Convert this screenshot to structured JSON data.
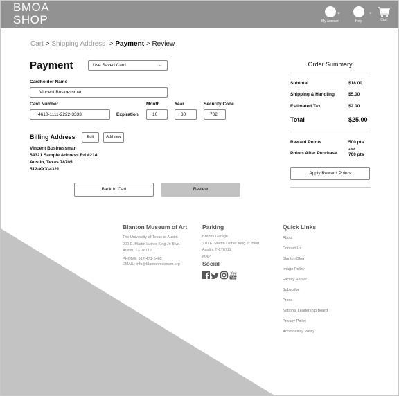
{
  "header": {
    "logo_line1": "BMOA",
    "logo_line2": "SHOP",
    "account_label": "My Account",
    "help_label": "Help",
    "cart_label": "Cart"
  },
  "breadcrumb": {
    "cart": "Cart",
    "sep1": ">",
    "shipping": "Shipping Address",
    "sep2": ">",
    "payment": "Payment",
    "sep3": ">",
    "review": "Review"
  },
  "payment": {
    "title": "Payment",
    "saved_card_select": "Use Saved Card",
    "cardholder_label": "Cardholder Name",
    "cardholder_value": "Vincent Businessman",
    "card_number_label": "Card Number",
    "card_number_value": "4610-1111-2222-3333",
    "expiration_label": "Expiration",
    "month_label": "Month",
    "month_value": "10",
    "year_label": "Year",
    "year_value": "30",
    "security_label": "Security Code",
    "security_value": "702"
  },
  "billing": {
    "title": "Billing Address",
    "edit_label": "Edit",
    "add_new_label": "Add new",
    "name": "Vincent Businessman",
    "street": "54321 Sample Address Rd #214",
    "city": "Austin, Texas 78705",
    "phone": "512-XXX-4321"
  },
  "actions": {
    "back_label": "Back to Cart",
    "review_label": "Review"
  },
  "summary": {
    "title": "Order Summary",
    "subtotal_label": "Subtotal",
    "subtotal_value": "$18.00",
    "shipping_label": "Shipping & Handling",
    "shipping_value": "$5.00",
    "tax_label": "Estimated Tax",
    "tax_value": "$2.00",
    "total_label": "Total",
    "total_value": "$25.00",
    "reward_label": "Reward Points",
    "reward_value": "500 pts",
    "after_label": "Points After Purchase",
    "after_plus": "+200",
    "after_value": "700 pts",
    "apply_label": "Apply Reward Points"
  },
  "footer": {
    "museum_title": "Blanton Museum of Art",
    "museum_line1": "The University of Texas at Austin",
    "museum_line2": "200 E. Martin Luther King Jr. Blvd.",
    "museum_line3": "Austin, TX 78712",
    "phone": "PHONE: 512-471-5482",
    "email": "EMAIL: info@blantonmuseum.org",
    "parking_title": "Parking",
    "parking_line1": "Brazos Garage",
    "parking_line2": "210 E. Martin Luther King Jr. Blvd.",
    "parking_line3": "Austin, TX 78712",
    "parking_map": "MAP",
    "social_title": "Social",
    "youtube_glyph_line1": "You",
    "youtube_glyph_line2": "Tube",
    "quick_title": "Quick Links",
    "links": [
      "About",
      "Contact Us",
      "Blanton Blog",
      "Image Policy",
      "Facility Rental",
      "Subscribe",
      "Press",
      "National Leadership Board",
      "Privacy Policy",
      "Accessibility Policy"
    ]
  },
  "colors": {
    "header_bg": "#929292",
    "review_btn_bg": "#c2c2c2",
    "triangle": "#c3c3c3"
  }
}
